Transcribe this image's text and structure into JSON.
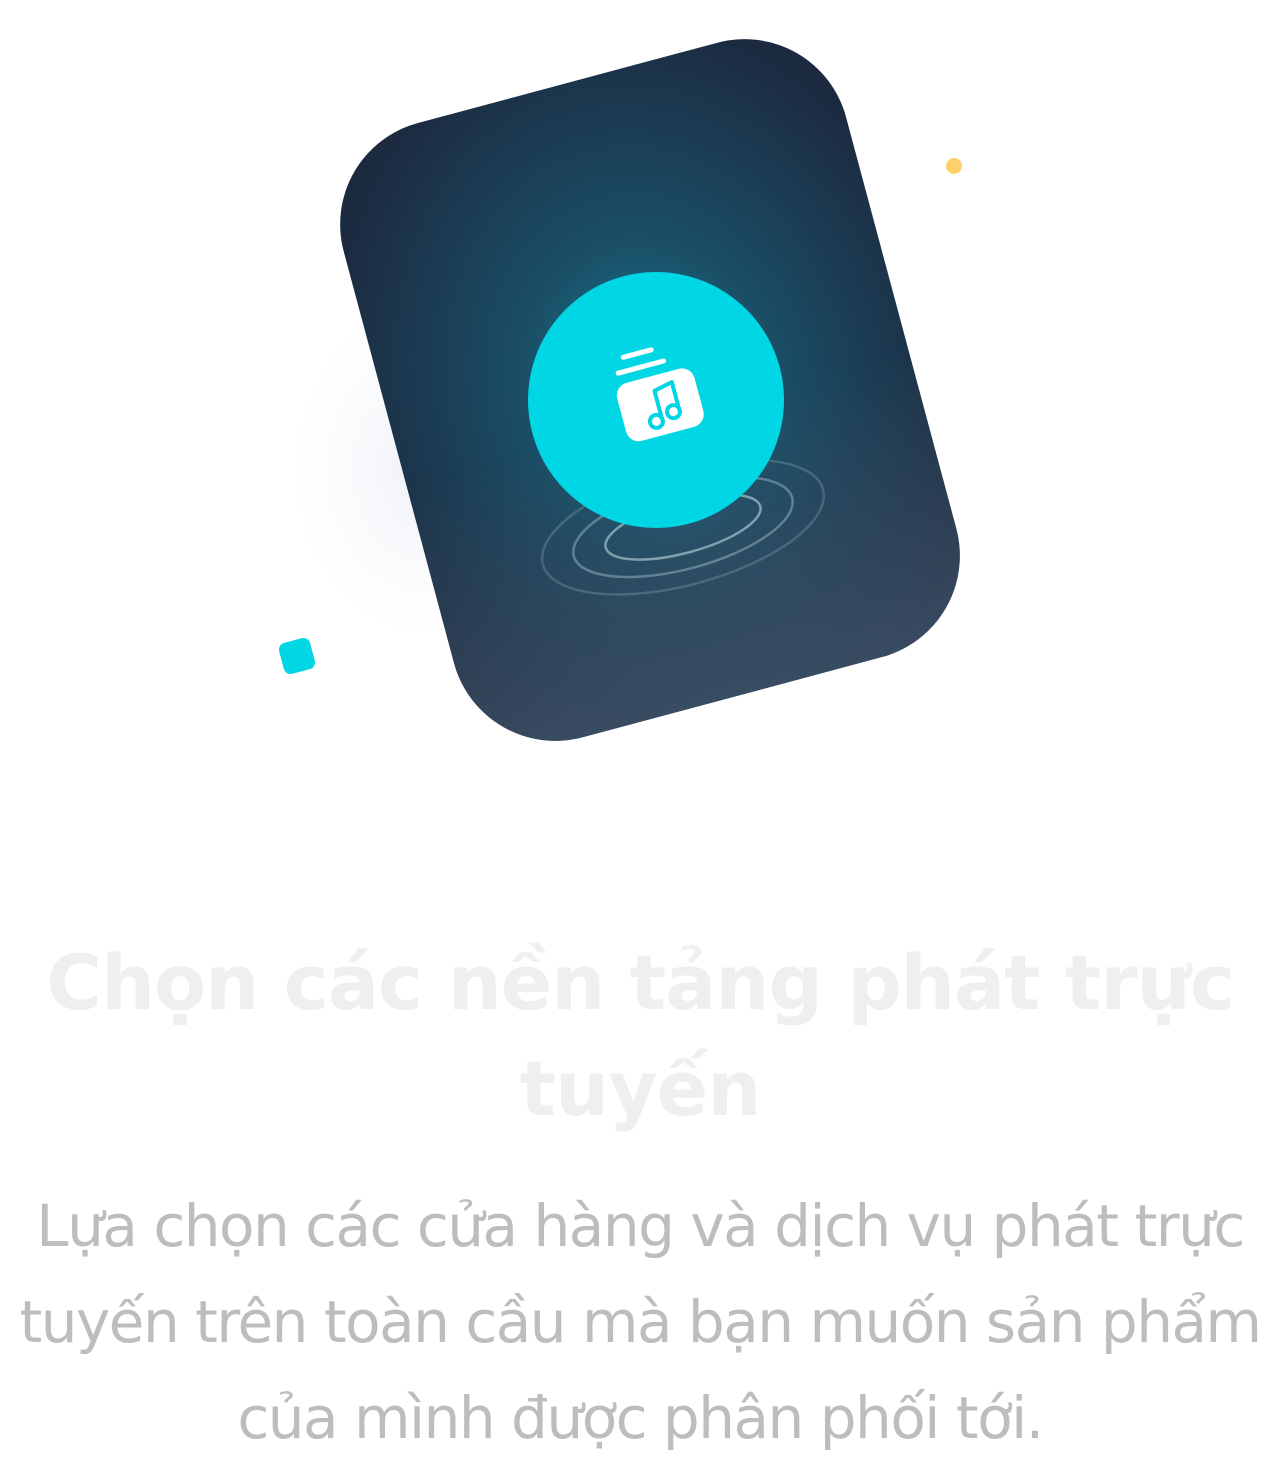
{
  "feature": {
    "title": "Chọn các nền tảng phát trực tuyến",
    "description": "Lựa chọn các cửa hàng và dịch vụ phát trực tuyến trên toàn cầu mà bạn muốn sản phẩm của mình được phân phối tới."
  },
  "illustration": {
    "icon": "music-library-icon",
    "colors": {
      "card_dark": "#1c2a40",
      "card_light": "#3e5166",
      "accent_cyan": "#00d6e4",
      "accent_yellow": "#fdd06a",
      "shadow": "#f3f4f8"
    }
  }
}
